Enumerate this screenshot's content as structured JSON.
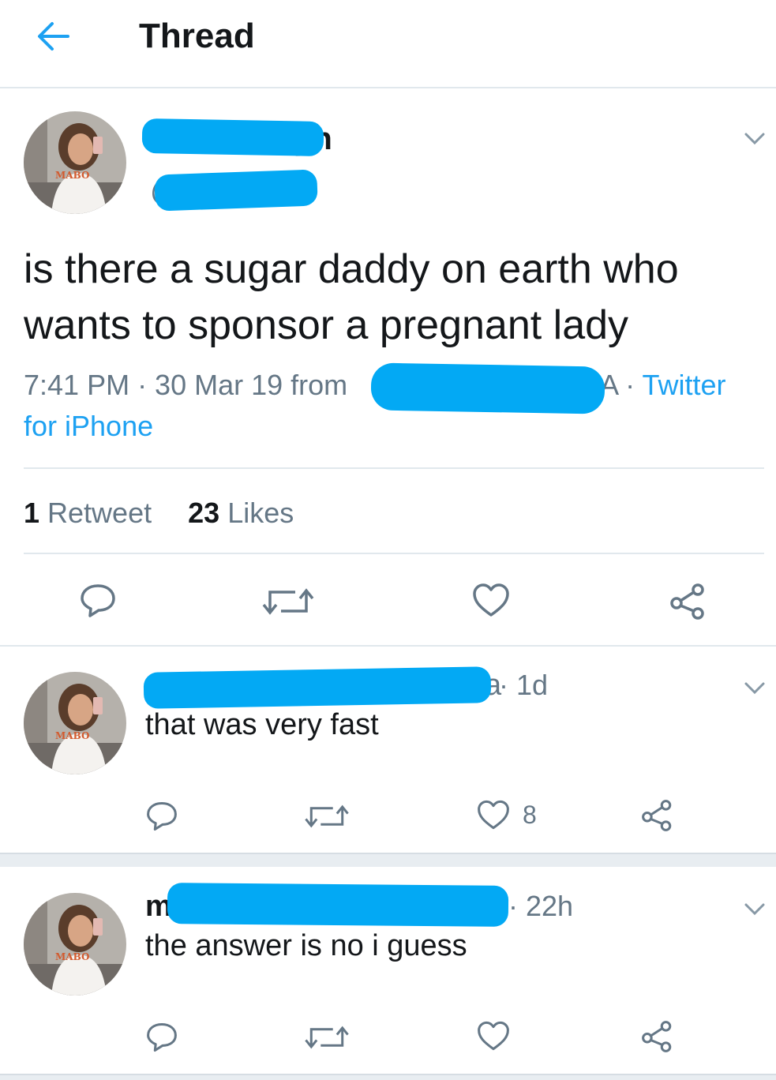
{
  "header": {
    "title": "Thread",
    "back_icon": "arrow-left-icon",
    "accent": "#1da1f2"
  },
  "main_tweet": {
    "name_fragment": "ph",
    "handle_prefix": "@",
    "text": "is there a sugar daddy on earth who wants to sponsor a pregnant lady",
    "time": "7:41 PM · 30 Mar 19 from ",
    "location_fragment": "MA",
    "source_sep": " · ",
    "source": "Twitter for iPhone",
    "retweets_count": "1",
    "retweets_label": " Retweet",
    "likes_count": "23",
    "likes_label": " Likes"
  },
  "replies": [
    {
      "handle_fragment": "a",
      "time": " · 1d",
      "text": "that was very fast",
      "likes": "8"
    },
    {
      "name_fragment": "m",
      "time": " · 22h",
      "text": "the answer is no i guess",
      "likes": ""
    }
  ],
  "colors": {
    "redaction": "#03a9f4",
    "muted": "#657786",
    "border": "#e1e8ed",
    "text": "#14171a"
  }
}
